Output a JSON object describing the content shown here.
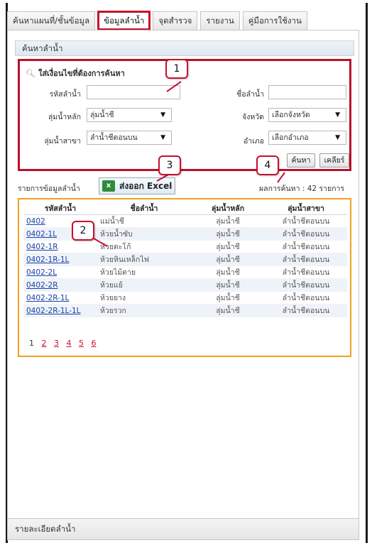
{
  "tabs": [
    {
      "label": "ค้นหาแผนที่/ชั้นข้อมูล"
    },
    {
      "label": "ข้อมูลลำน้ำ"
    },
    {
      "label": "จุดสำรวจ"
    },
    {
      "label": "รายงาน"
    },
    {
      "label": "คู่มือการใช้งาน"
    }
  ],
  "panel_title": "ค้นหาลำน้ำ",
  "search": {
    "heading": "ใส่เงื่อนไขที่ต้องการค้นหา",
    "river_code_label": "รหัสลำน้ำ",
    "river_name_label": "ชื่อลำน้ำ",
    "main_basin_label": "ลุ่มน้ำหลัก",
    "main_basin_value": "ลุ่มน้ำชี",
    "province_label": "จังหวัด",
    "province_value": "เลือกจังหวัด",
    "sub_basin_label": "ลุ่มน้ำสาขา",
    "sub_basin_value": "ลำน้ำชีตอนบน",
    "district_label": "อำเภอ",
    "district_value": "เลือกอำเภอ",
    "search_button": "ค้นหา",
    "clear_button": "เคลียร์"
  },
  "list_label": "รายการข้อมูลลำน้ำ",
  "export_button": "ส่งออก Excel",
  "result_text": "ผลการค้นหา : 42 รายการ",
  "table": {
    "headers": [
      "รหัสลำน้ำ",
      "ชื่อลำน้ำ",
      "ลุ่มน้ำหลัก",
      "ลุ่มน้ำสาขา"
    ],
    "rows": [
      [
        "0402",
        "แม่น้ำชี",
        "ลุ่มน้ำชี",
        "ลำน้ำชีตอนบน"
      ],
      [
        "0402-1L",
        "ห้วยน้ำซับ",
        "ลุ่มน้ำชี",
        "ลำน้ำชีตอนบน"
      ],
      [
        "0402-1R",
        "ห้วยตะโก้",
        "ลุ่มน้ำชี",
        "ลำน้ำชีตอนบน"
      ],
      [
        "0402-1R-1L",
        "ห้วยหินเหล็กไฟ",
        "ลุ่มน้ำชี",
        "ลำน้ำชีตอนบน"
      ],
      [
        "0402-2L",
        "ห้วยไม้ตาย",
        "ลุ่มน้ำชี",
        "ลำน้ำชีตอนบน"
      ],
      [
        "0402-2R",
        "ห้วยแย้",
        "ลุ่มน้ำชี",
        "ลำน้ำชีตอนบน"
      ],
      [
        "0402-2R-1L",
        "ห้วยยาง",
        "ลุ่มน้ำชี",
        "ลำน้ำชีตอนบน"
      ],
      [
        "0402-2R-1L-1L",
        "ห้วยรวก",
        "ลุ่มน้ำชี",
        "ลำน้ำชีตอนบน"
      ]
    ]
  },
  "pager": [
    "1",
    "2",
    "3",
    "4",
    "5",
    "6"
  ],
  "callouts": [
    "1",
    "2",
    "3",
    "4"
  ],
  "detail_bar": "รายละเอียดลำน้ำ",
  "colors": {
    "highlight_red": "#c8102e",
    "grid_orange": "#f0a020",
    "link_blue": "#1a3fa6"
  }
}
